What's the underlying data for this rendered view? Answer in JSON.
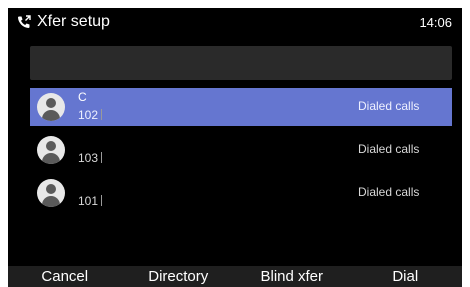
{
  "header": {
    "title": "Xfer setup",
    "clock": "14:06",
    "icon": "phone-transfer-icon"
  },
  "search": {
    "value": ""
  },
  "contacts": [
    {
      "name": "C",
      "number": "102",
      "type": "Dialed calls",
      "selected": true
    },
    {
      "name": "",
      "number": "103",
      "type": "Dialed calls",
      "selected": false
    },
    {
      "name": "",
      "number": "101",
      "type": "Dialed calls",
      "selected": false
    }
  ],
  "softkeys": {
    "cancel": "Cancel",
    "directory": "Directory",
    "blind_xfer": "Blind xfer",
    "dial": "Dial"
  },
  "colors": {
    "selected_row": "#6576d0",
    "background": "#000000",
    "softkey_bar": "#1f1f1f"
  }
}
